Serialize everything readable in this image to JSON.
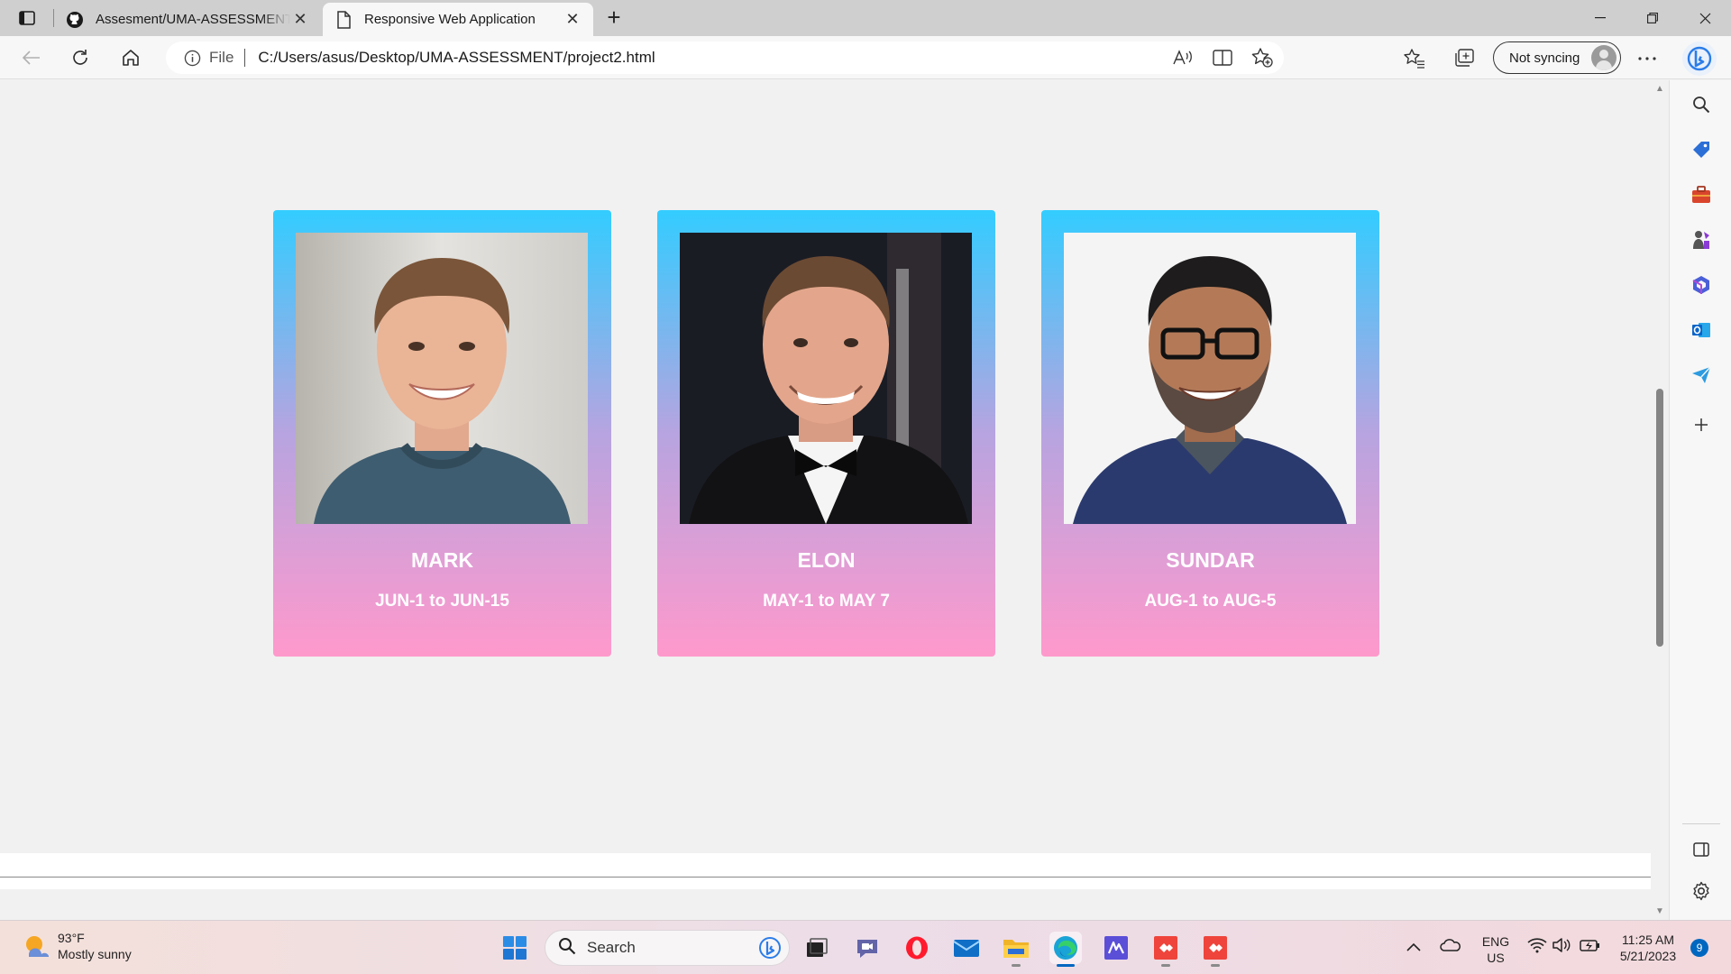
{
  "browser": {
    "tabs": [
      {
        "title": "Assesment/UMA-ASSESSMENT at main",
        "active": false,
        "icon": "github-icon"
      },
      {
        "title": "Responsive Web Application",
        "active": true,
        "icon": "page-icon"
      }
    ],
    "address": {
      "scheme_label": "File",
      "url": "C:/Users/asus/Desktop/UMA-ASSESSMENT/project2.html"
    },
    "profile": {
      "sync_label": "Not syncing"
    }
  },
  "page": {
    "cards": [
      {
        "name": "MARK",
        "dates": "JUN-1 to JUN-15",
        "photo": "mark-photo"
      },
      {
        "name": "ELON",
        "dates": "MAY-1 to MAY 7",
        "photo": "elon-photo"
      },
      {
        "name": "SUNDAR",
        "dates": "AUG-1 to AUG-5",
        "photo": "sundar-photo"
      }
    ],
    "card_gradient": [
      "#33ccff",
      "#ff99cc"
    ]
  },
  "taskbar": {
    "weather": {
      "temp": "93°F",
      "condition": "Mostly sunny"
    },
    "search_placeholder": "Search",
    "language": {
      "lang": "ENG",
      "region": "US"
    },
    "clock": {
      "time": "11:25 AM",
      "date": "5/21/2023"
    },
    "notifications": "9"
  }
}
